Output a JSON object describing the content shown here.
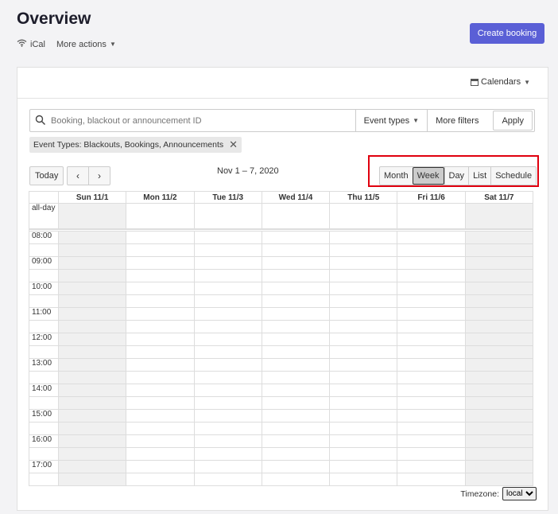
{
  "header": {
    "title": "Overview",
    "ical_label": "iCal",
    "more_actions_label": "More actions",
    "create_button": "Create booking"
  },
  "toolbar": {
    "calendars_label": "Calendars"
  },
  "search": {
    "placeholder": "Booking, blackout or announcement ID",
    "event_types_label": "Event types",
    "more_filters_label": "More filters",
    "apply_label": "Apply"
  },
  "filter_chip": {
    "label": "Event Types: Blackouts, Bookings, Announcements"
  },
  "nav": {
    "today": "Today",
    "prev": "‹",
    "next": "›",
    "date_range": "Nov 1 – 7, 2020"
  },
  "views": [
    {
      "label": "Month"
    },
    {
      "label": "Week",
      "active": true
    },
    {
      "label": "Day"
    },
    {
      "label": "List"
    },
    {
      "label": "Schedule"
    }
  ],
  "calendar": {
    "days": [
      "Sun 11/1",
      "Mon 11/2",
      "Tue 11/3",
      "Wed 11/4",
      "Thu 11/5",
      "Fri 11/6",
      "Sat 11/7"
    ],
    "allday_label": "all-day",
    "times": [
      "08:00",
      "09:00",
      "10:00",
      "11:00",
      "12:00",
      "13:00",
      "14:00",
      "15:00",
      "16:00",
      "17:00"
    ]
  },
  "timezone": {
    "label": "Timezone:",
    "selected": "local"
  }
}
